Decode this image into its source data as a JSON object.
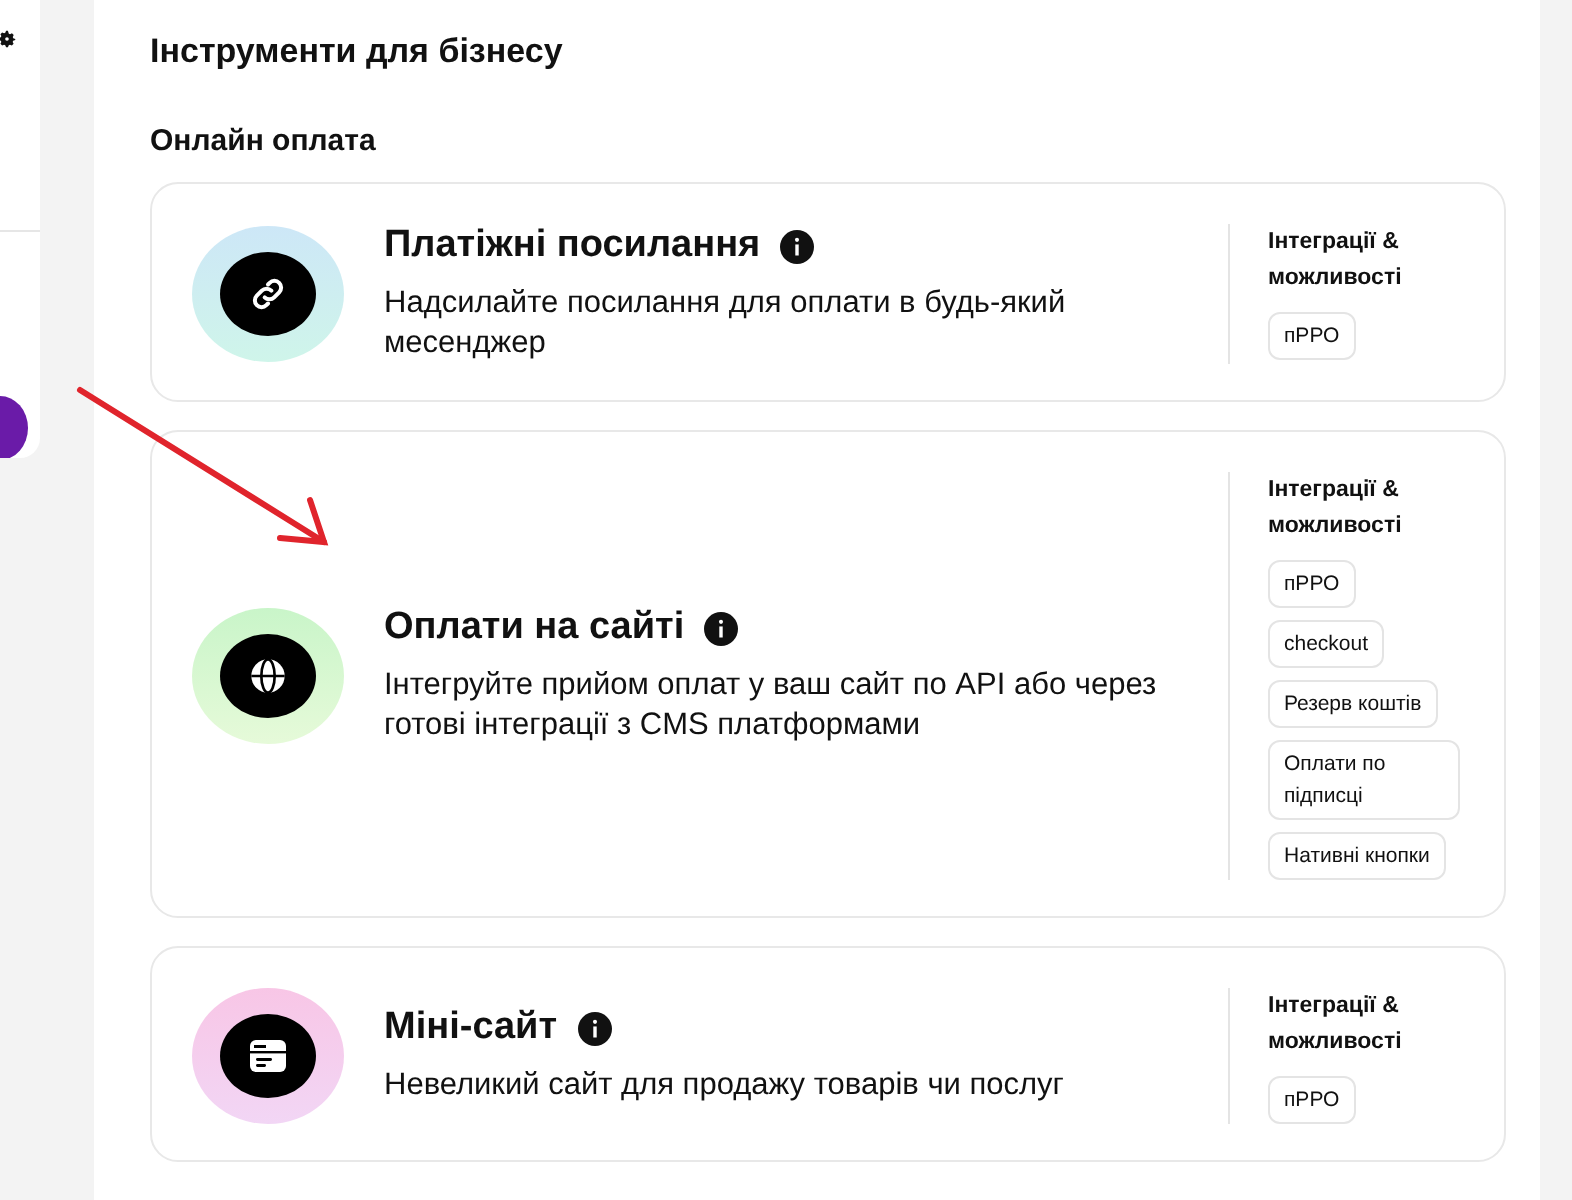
{
  "page_title": "Інструменти для бізнесу",
  "section_title": "Онлайн оплата",
  "products": [
    {
      "kind": "link",
      "title": "Платіжні посилання",
      "description": "Надсилайте посилання для оплати в будь-який месенджер",
      "features_heading": "Інтеграції & можливості",
      "features": [
        "пРРО"
      ]
    },
    {
      "kind": "globe",
      "title": "Оплати на сайті",
      "description": "Інтегруйте прийом оплат у ваш сайт по API або через готові інтеграції з CMS платформами",
      "features_heading": "Інтеграції & можливості",
      "features": [
        "пРРО",
        "checkout",
        "Резерв коштів",
        "Оплати по підписці",
        "Нативні кнопки"
      ]
    },
    {
      "kind": "site",
      "title": "Міні-сайт",
      "description": "Невеликий сайт для продажу товарів чи послуг",
      "features_heading": "Інтеграції & можливості",
      "features": [
        "пРРО"
      ]
    }
  ]
}
